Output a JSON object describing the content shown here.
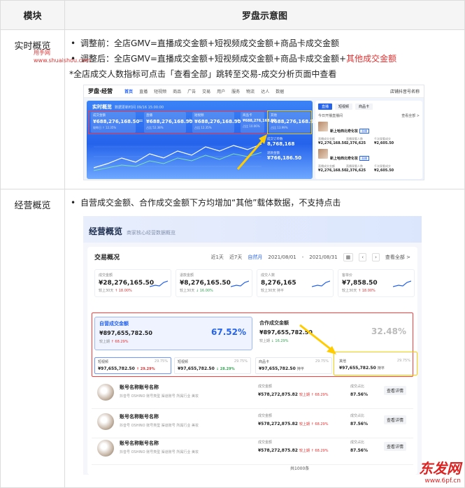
{
  "table": {
    "col1": "模块",
    "col2": "罗盘示意图"
  },
  "row1": {
    "module": "实时概览",
    "b1": "调整前：全店GMV=直播成交金额+短视频成交金额+商品卡成交金额",
    "b2_main": "调整后：全店GMV=直播成交金额+短视频成交金额+商品卡成交金额+",
    "b2_red": "其他成交金额",
    "note": "*全店成交人数指标可点击「查看全部」跳转至交易-成交分析页面中查看"
  },
  "ss1": {
    "logo": "罗盘·经营",
    "nav": [
      "首页",
      "直播",
      "短视频",
      "商品",
      "广告",
      "交易",
      "用户",
      "服务",
      "物流",
      "达人",
      "数据"
    ],
    "user": "店铺抖音号名称",
    "header": "实时概览",
    "header_sub": "数据更新时间 09/16 15:00:00",
    "cards": [
      {
        "l": "成交金额",
        "v": "¥688,276,168.50",
        "s": "较昨日 ↑ 12.35%"
      },
      {
        "l": "直播",
        "v": "¥688,276,168.50",
        "s": "占比 52.38%"
      },
      {
        "l": "短视频",
        "v": "¥688,276,168.50",
        "s": "占比 12.35%"
      },
      {
        "l": "商品卡",
        "v": "¥688,276,168.50",
        "s": "占比 10.06%"
      },
      {
        "l": "其他",
        "v": "¥688,276,168.50",
        "s": "占比 13.99%"
      }
    ],
    "kpis": [
      {
        "l": "成交订单数",
        "v": "8,768,168"
      },
      {
        "l": "退款金额",
        "v": "¥766,186.50"
      }
    ],
    "side_tabs": [
      "直播",
      "短视频",
      "商品卡"
    ],
    "side_title": "今日开播直播间",
    "side_more": "查看全部 >",
    "products": [
      {
        "nm": "新上哈西北奇化妆",
        "tag": "直播",
        "m": [
          "¥2,276,168.50",
          "2,376,625",
          "¥2,605.50"
        ]
      },
      {
        "nm": "新上哈西北奇化妆",
        "tag": "直播",
        "m": [
          "¥2,276,168.50",
          "2,376,625",
          "¥2,605.50"
        ]
      }
    ],
    "mlabels": [
      "直播成交金额",
      "直播观看人数",
      "千次观看成交"
    ],
    "colors": {
      "blue": "#2563eb",
      "red": "#ff3b3b",
      "yellow": "#ffcc00"
    }
  },
  "row2": {
    "module": "经营概览",
    "b1": "自营成交金额、合作成交金额下方均增加“其他”载体数据，不支持点击"
  },
  "ss2": {
    "title": "经营概览",
    "subtitle": "商家核心经营数据概览",
    "section": "交易概况",
    "ranges": [
      "近1天",
      "近7天",
      "自然月"
    ],
    "date_from": "2021/08/01",
    "date_to": "2021/08/31",
    "more": "查看全部 >",
    "kpis": [
      {
        "l": "成交金额",
        "v": "¥28,276,165.50",
        "s": "较上30天",
        "d": "↑ 18.00%",
        "up": true
      },
      {
        "l": "退款金额",
        "v": "¥8,276,165.50",
        "s": "较上30天",
        "d": "↓ 16.00%",
        "up": false
      },
      {
        "l": "成交人数",
        "v": "8,276,165",
        "s": "较上30天",
        "d": "持平",
        "up": null
      },
      {
        "l": "客单价",
        "v": "¥7,858.50",
        "s": "较上30天",
        "d": "↑ 18.00%",
        "up": true
      }
    ],
    "self": {
      "l": "自营成交金额",
      "v": "¥897,655,782.50",
      "s": "较上期",
      "d": "↑ 68.29%",
      "pct": "67.52%"
    },
    "coop": {
      "l": "合作成交金额",
      "v": "¥897,655,782.50",
      "s": "较上期",
      "d": "↓ 16.29%",
      "pct": "32.48%"
    },
    "carriers": [
      {
        "l": "短视频",
        "p": "29.75%",
        "v": "¥97,655,782.50",
        "d": "↑ 29.29%"
      },
      {
        "l": "短视频",
        "p": "29.75%",
        "v": "¥97,655,782.50",
        "d": "↓ 28.29%"
      },
      {
        "l": "商品卡",
        "p": "29.75%",
        "v": "¥97,655,782.50",
        "d": "持平"
      },
      {
        "l": "其他",
        "p": "29.75%",
        "v": "¥97,655,782.50",
        "d": "持平"
      }
    ],
    "accounts": [
      {
        "nm": "账号名称账号名称",
        "meta": "抖音号  OSHINO    账号类型  渠道账号    所属行业  美妆",
        "l1": "成交金额",
        "v1": "¥578,272,875.82",
        "d1": "较上期 ↑ 68.29%",
        "l2": "成交占比",
        "v2": "87.56%",
        "btn": "查看详情"
      },
      {
        "nm": "账号名称账号名称",
        "meta": "抖音号  OSHINO    账号类型  渠道账号    所属行业  美妆",
        "l1": "成交金额",
        "v1": "¥578,272,875.82",
        "d1": "较上期 ↑ 68.29%",
        "l2": "成交占比",
        "v2": "87.56%",
        "btn": "查看详情"
      },
      {
        "nm": "账号名称账号名称",
        "meta": "抖音号  OSHINO    账号类型  渠道账号    所属行业  美妆",
        "l1": "成交金额",
        "v1": "¥578,272,875.82",
        "d1": "较上期 ↑ 68.29%",
        "l2": "成交占比",
        "v2": "87.56%",
        "btn": "查看详情"
      }
    ],
    "total": "共1000条"
  },
  "watermarks": {
    "w1a": "甩手网",
    "w1b": "www.shuaishou.com",
    "w2a": "东发网",
    "w2b": "www.6pf.cn"
  }
}
